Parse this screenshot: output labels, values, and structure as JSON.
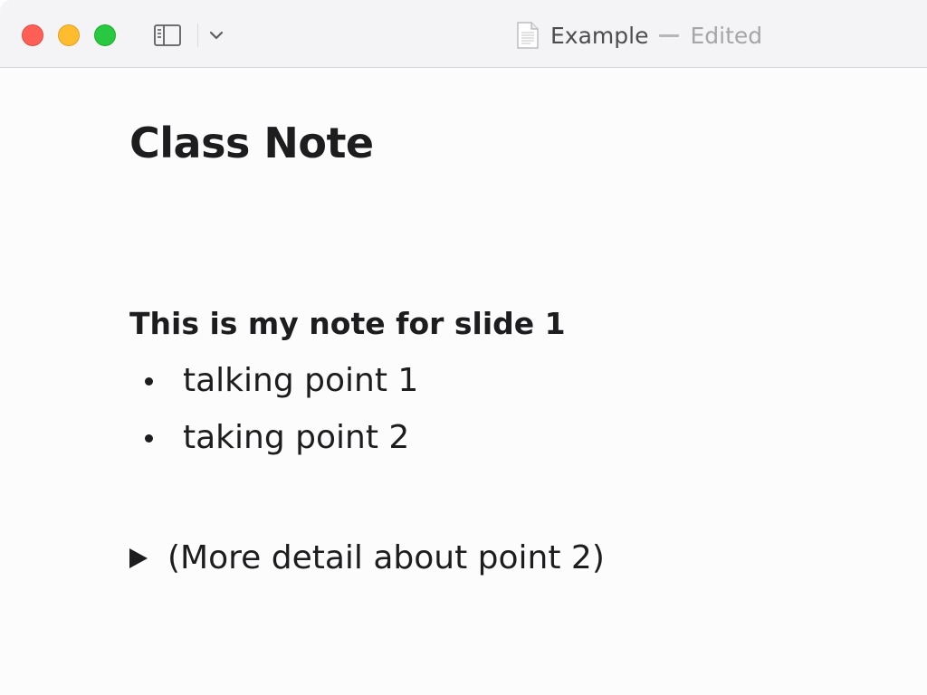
{
  "window": {
    "title": "Example",
    "status": "Edited",
    "icons": {
      "close": "close-icon",
      "minimize": "minimize-icon",
      "maximize": "maximize-icon",
      "sidebar": "sidebar-icon",
      "chevron": "chevron-down-icon",
      "document": "document-icon"
    }
  },
  "document": {
    "heading": "Class Note",
    "section_title": "This is my note for slide 1",
    "bullets": [
      "talking point 1",
      "taking point 2"
    ],
    "disclosure": {
      "label": "(More detail about point 2)",
      "expanded": false
    }
  },
  "colors": {
    "close": "#ff5f57",
    "minimize": "#febc2e",
    "maximize": "#28c840",
    "text": "#1d1d1f",
    "titlebar": "#f4f4f6"
  }
}
